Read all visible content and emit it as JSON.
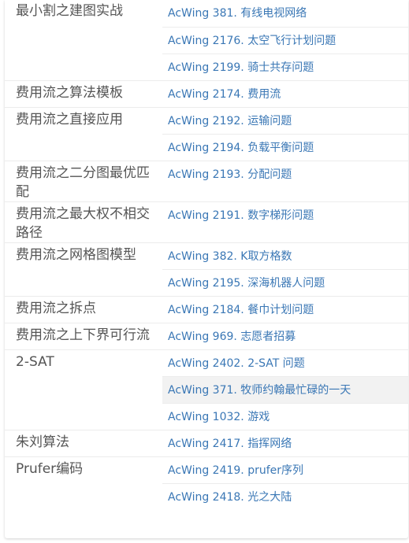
{
  "topics": [
    {
      "name": "最小割之建图实战",
      "problems": [
        "AcWing 381. 有线电视网络",
        "AcWing 2176. 太空飞行计划问题",
        "AcWing 2199. 骑士共存问题"
      ]
    },
    {
      "name": "费用流之算法模板",
      "problems": [
        "AcWing 2174. 费用流"
      ]
    },
    {
      "name": "费用流之直接应用",
      "problems": [
        "AcWing 2192. 运输问题",
        "AcWing 2194. 负载平衡问题"
      ]
    },
    {
      "name": "费用流之二分图最优匹配",
      "problems": [
        "AcWing 2193. 分配问题"
      ]
    },
    {
      "name": "费用流之最大权不相交路径",
      "problems": [
        "AcWing 2191. 数字梯形问题"
      ]
    },
    {
      "name": "费用流之网格图模型",
      "problems": [
        "AcWing 382. K取方格数",
        "AcWing 2195. 深海机器人问题"
      ]
    },
    {
      "name": "费用流之拆点",
      "problems": [
        "AcWing 2184. 餐巾计划问题"
      ]
    },
    {
      "name": "费用流之上下界可行流",
      "problems": [
        "AcWing 969. 志愿者招募"
      ]
    },
    {
      "name": "2-SAT",
      "problems": [
        "AcWing 2402. 2-SAT 问题",
        "AcWing 371. 牧师约翰最忙碌的一天",
        "AcWing 1032. 游戏"
      ]
    },
    {
      "name": "朱刘算法",
      "problems": [
        "AcWing 2417. 指挥网络"
      ]
    },
    {
      "name": "Prufer编码",
      "problems": [
        "AcWing 2419. prufer序列",
        "AcWing 2418. 光之大陆"
      ]
    }
  ]
}
